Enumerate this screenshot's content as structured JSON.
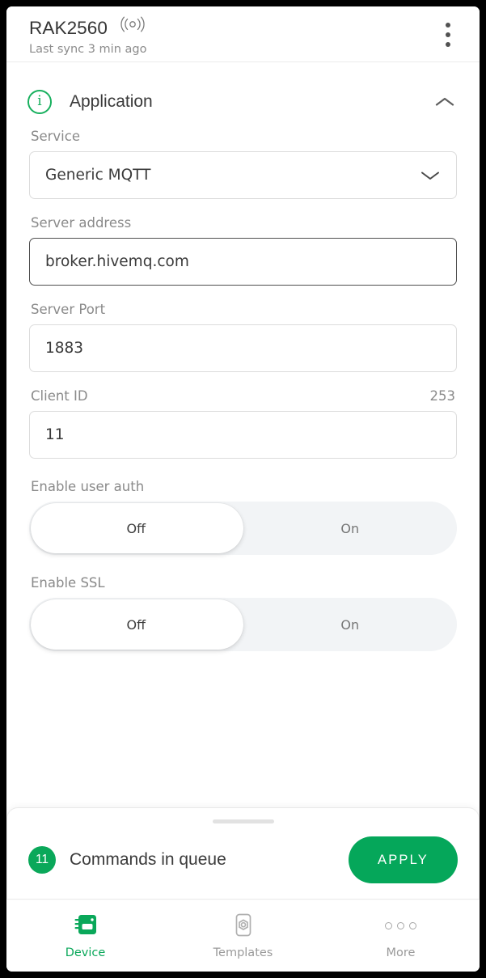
{
  "appbar": {
    "device_name": "RAK2560",
    "signal_icon": "signal-waves-icon",
    "last_sync": "Last sync 3 min ago",
    "menu_icon": "kebab-menu-icon"
  },
  "section": {
    "icon": "info-circle-icon",
    "icon_glyph": "i",
    "title": "Application",
    "collapse_icon": "chevron-up-icon"
  },
  "fields": {
    "service": {
      "label": "Service",
      "value": "Generic MQTT",
      "dropdown_icon": "chevron-down-icon"
    },
    "server_address": {
      "label": "Server address",
      "value": "broker.hivemq.com",
      "placeholder": "Server address"
    },
    "server_port": {
      "label": "Server Port",
      "value": "1883",
      "placeholder": "Server Port"
    },
    "client_id": {
      "label": "Client ID",
      "counter": "253",
      "value": "11",
      "placeholder": "Client ID"
    }
  },
  "toggles": {
    "user_auth": {
      "label": "Enable user auth",
      "off_label": "Off",
      "on_label": "On",
      "selected": "Off"
    },
    "ssl": {
      "label": "Enable SSL",
      "off_label": "Off",
      "on_label": "On",
      "selected": "Off"
    }
  },
  "sheet": {
    "drag_handle": "sheet-drag-handle",
    "queue_count": "11",
    "queue_label": "Commands in queue",
    "apply_label": "APPLY"
  },
  "bottom_nav": {
    "items": [
      {
        "label": "Device",
        "icon": "device-chip-icon",
        "active": true
      },
      {
        "label": "Templates",
        "icon": "template-nut-icon",
        "active": false
      },
      {
        "label": "More",
        "icon": "more-dots-icon",
        "active": false
      }
    ]
  },
  "colors": {
    "accent_green": "#0aa85a",
    "apply_green": "#05a75a",
    "label_gray": "#8a8a8a",
    "text_dark": "#3a3a3a",
    "track_gray": "#f2f4f6"
  }
}
